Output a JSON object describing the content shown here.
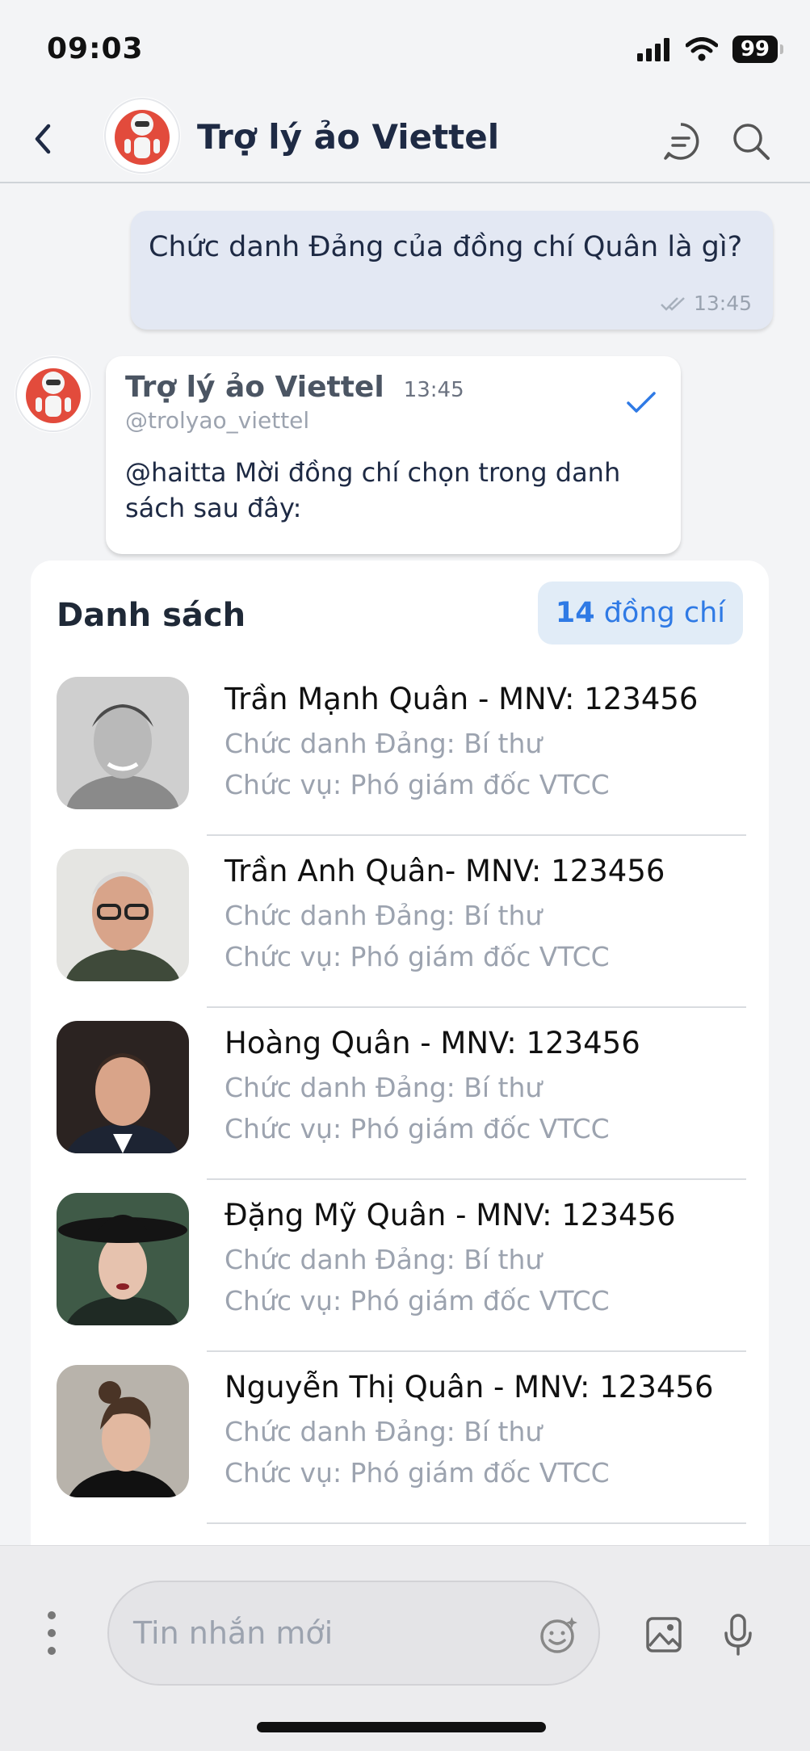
{
  "status": {
    "time": "09:03",
    "battery": "99"
  },
  "header": {
    "title": "Trợ lý ảo Viettel"
  },
  "outgoing": {
    "text": "Chức danh Đảng của đồng chí Quân là gì?",
    "time": "13:45"
  },
  "incoming": {
    "sender": "Trợ lý ảo Viettel",
    "time": "13:45",
    "handle": "@trolyao_viettel",
    "body": "@haitta Mời đồng chí chọn trong danh sách sau đây:"
  },
  "list": {
    "title": "Danh sách",
    "count": "14",
    "count_unit": " đồng chí",
    "items": [
      {
        "name": "Trần Mạnh Quân - MNV: 123456",
        "party_title": "Chức danh Đảng: Bí thư",
        "position": "Chức vụ: Phó giám đốc VTCC"
      },
      {
        "name": "Trần Anh Quân- MNV: 123456",
        "party_title": "Chức danh Đảng: Bí thư",
        "position": "Chức vụ: Phó giám đốc VTCC"
      },
      {
        "name": "Hoàng Quân - MNV: 123456",
        "party_title": "Chức danh Đảng: Bí thư",
        "position": "Chức vụ: Phó giám đốc VTCC"
      },
      {
        "name": "Đặng Mỹ Quân - MNV: 123456",
        "party_title": "Chức danh Đảng: Bí thư",
        "position": "Chức vụ: Phó giám đốc VTCC"
      },
      {
        "name": "Nguyễn Thị Quân - MNV: 123456",
        "party_title": "Chức danh Đảng: Bí thư",
        "position": "Chức vụ: Phó giám đốc VTCC"
      }
    ]
  },
  "composer": {
    "placeholder": "Tin nhắn mới"
  },
  "colors": {
    "accent": "#2f7ae5",
    "outgoing_bubble": "#e3e8f3",
    "badge_bg": "#e1ecf7"
  },
  "icons": [
    "back-icon",
    "chat-icon",
    "search-icon",
    "signal-icon",
    "wifi-icon",
    "check-icon",
    "double-check-icon",
    "more-icon",
    "emoji-icon",
    "image-icon",
    "mic-icon"
  ]
}
